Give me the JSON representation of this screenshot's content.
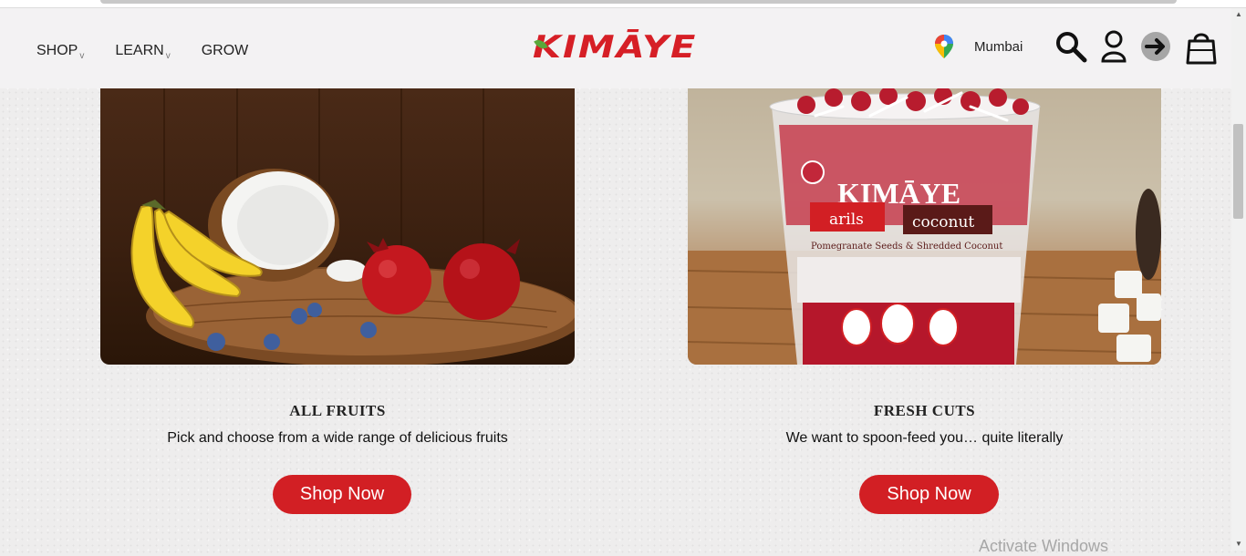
{
  "nav": {
    "items": [
      {
        "label": "SHOP",
        "has_dropdown": true
      },
      {
        "label": "LEARN",
        "has_dropdown": true
      },
      {
        "label": "GROW",
        "has_dropdown": false
      }
    ],
    "dropdown_glyph": "v"
  },
  "brand": {
    "logo_text": "KIMĀYE",
    "color": "#d61f26"
  },
  "location": {
    "city": "Mumbai",
    "icon": "map-pin-icon"
  },
  "header_icons": [
    "search-icon",
    "user-icon",
    "login-arrow-icon",
    "shopping-bag-icon"
  ],
  "cards": [
    {
      "title": "ALL FRUITS",
      "description": "Pick and choose from a wide range of delicious fruits",
      "button": "Shop Now"
    },
    {
      "title": "FRESH CUTS",
      "description": "We want to spoon-feed you… quite literally",
      "button": "Shop Now",
      "product_text": {
        "brand": "KIMĀYE",
        "tag1": "arils",
        "tag2": "coconut",
        "subtitle": "Pomegranate Seeds & Shredded Coconut"
      }
    }
  ],
  "watermark": "Activate Windows",
  "colors": {
    "accent": "#d21f24",
    "leaf_green": "#5aa83a"
  }
}
